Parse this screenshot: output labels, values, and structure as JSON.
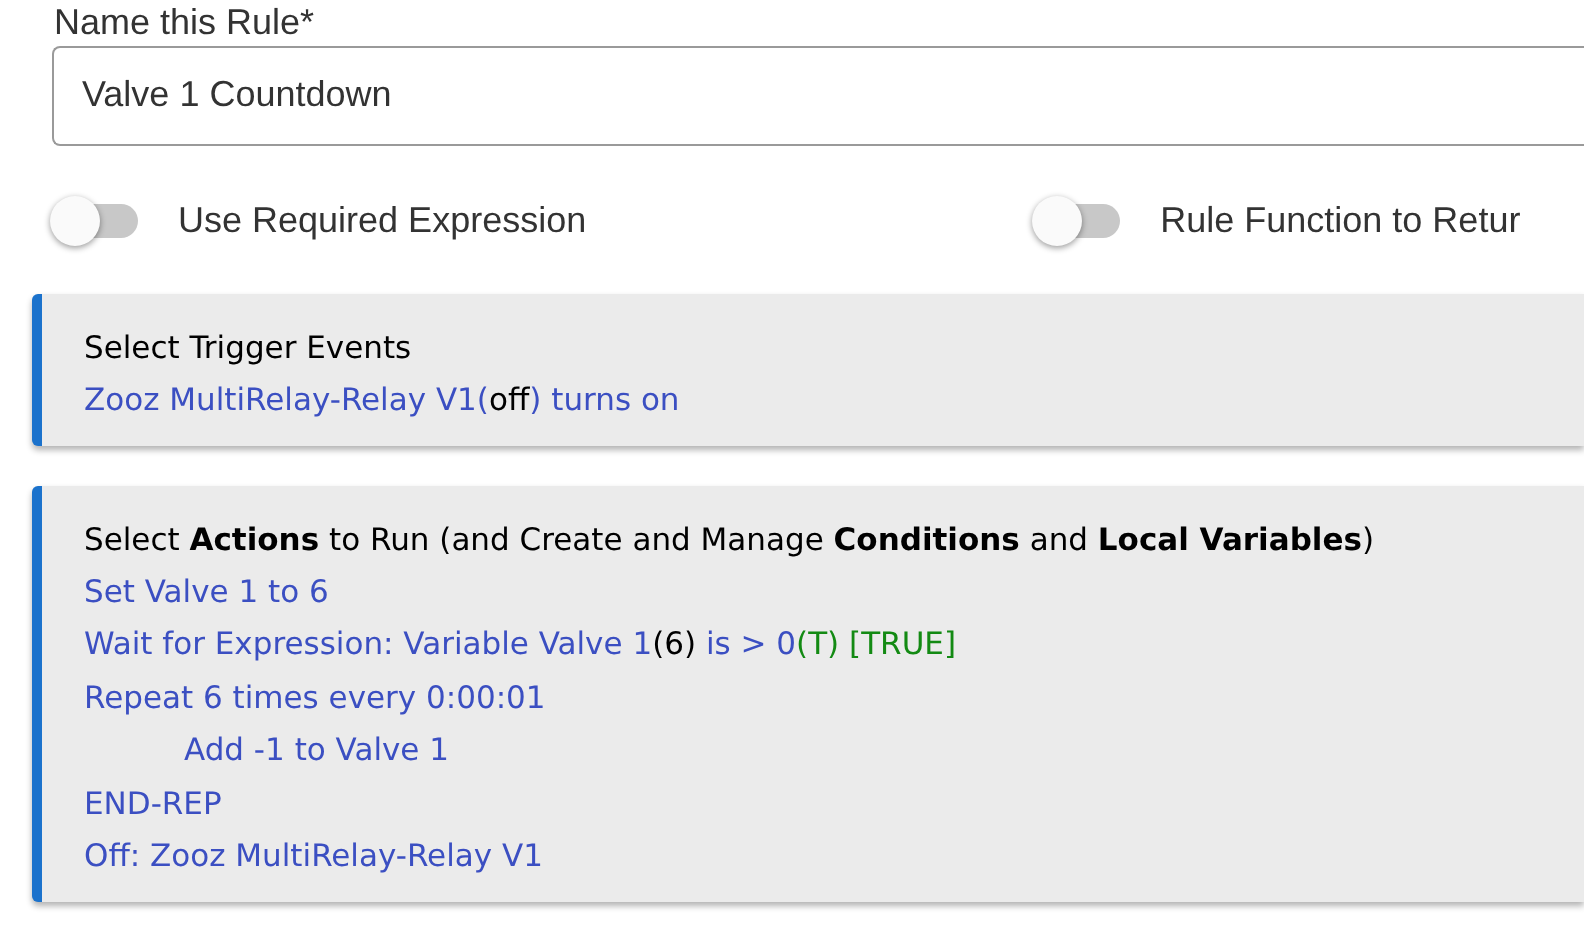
{
  "rule_name": {
    "label": "Name this Rule*",
    "value": "Valve 1 Countdown"
  },
  "toggles": [
    {
      "label": "Use Required Expression",
      "on": false
    },
    {
      "label": "Rule Function to Retur",
      "on": false
    }
  ],
  "trigger_panel": {
    "heading": "Select Trigger Events",
    "lines": [
      {
        "segments": [
          {
            "kind": "link",
            "text": "Zooz MultiRelay-Relay V1("
          },
          {
            "kind": "value",
            "text": "off"
          },
          {
            "kind": "link",
            "text": ") turns on"
          }
        ]
      }
    ]
  },
  "actions_panel": {
    "heading": "Select **Actions** to Run (and Create and Manage **Conditions** and **Local Variables**)",
    "lines": [
      {
        "segments": [
          {
            "kind": "link",
            "text": "Set Valve 1 to 6"
          }
        ]
      },
      {
        "segments": [
          {
            "kind": "link",
            "text": "Wait for Expression: Variable Valve 1"
          },
          {
            "kind": "value",
            "text": "(6)"
          },
          {
            "kind": "link",
            "text": " is > 0"
          },
          {
            "kind": "result",
            "text": "(T) [TRUE]"
          }
        ]
      },
      {
        "segments": [
          {
            "kind": "link",
            "text": "Repeat 6 times every 0:00:01"
          }
        ],
        "children": [
          {
            "segments": [
              {
                "kind": "link",
                "text": "Add -1 to Valve 1"
              }
            ]
          }
        ]
      },
      {
        "segments": [
          {
            "kind": "link",
            "text": "END-REP"
          }
        ]
      },
      {
        "segments": [
          {
            "kind": "link",
            "text": "Off: Zooz MultiRelay-Relay V1"
          }
        ]
      }
    ]
  }
}
